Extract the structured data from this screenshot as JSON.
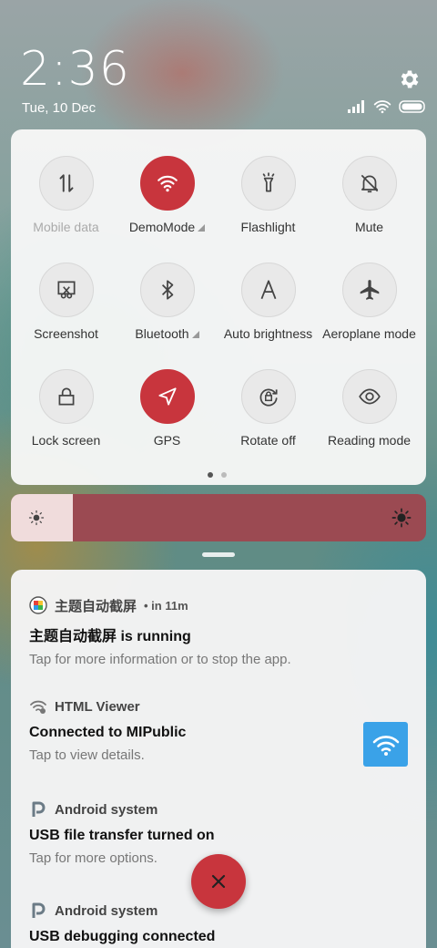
{
  "status": {
    "time": "2:36",
    "date": "Tue, 10 Dec"
  },
  "quick_settings": {
    "tiles": [
      {
        "label": "Mobile data",
        "icon": "mobile-data-icon",
        "active": false,
        "disabled": true
      },
      {
        "label": "DemoMode",
        "icon": "wifi-icon",
        "active": true,
        "expand": true
      },
      {
        "label": "Flashlight",
        "icon": "flashlight-icon",
        "active": false
      },
      {
        "label": "Mute",
        "icon": "bell-off-icon",
        "active": false
      },
      {
        "label": "Screenshot",
        "icon": "screenshot-icon",
        "active": false
      },
      {
        "label": "Bluetooth",
        "icon": "bluetooth-icon",
        "active": false,
        "expand": true
      },
      {
        "label": "Auto brightness",
        "icon": "auto-brightness-icon",
        "active": false
      },
      {
        "label": "Aeroplane mode",
        "icon": "airplane-icon",
        "active": false
      },
      {
        "label": "Lock screen",
        "icon": "lock-icon",
        "active": false
      },
      {
        "label": "GPS",
        "icon": "location-icon",
        "active": true
      },
      {
        "label": "Rotate off",
        "icon": "rotate-lock-icon",
        "active": false
      },
      {
        "label": "Reading mode",
        "icon": "eye-icon",
        "active": false
      }
    ],
    "page": 1,
    "page_count": 2
  },
  "brightness": {
    "level": 0.15
  },
  "notifications": [
    {
      "app": "主题自动截屏",
      "time": "• in 11m",
      "title": "主题自动截屏 is running",
      "text": "Tap for more information or to stop the app.",
      "icon": "theme-app-icon"
    },
    {
      "app": "HTML Viewer",
      "time": "",
      "title": "Connected to MIPublic",
      "text": "Tap to view details.",
      "icon": "wifi-settings-icon"
    },
    {
      "app": "Android system",
      "time": "",
      "title": "USB file transfer turned on",
      "text": "Tap for more options.",
      "icon": "android-system-icon"
    },
    {
      "app": "Android system",
      "time": "",
      "title": "USB debugging connected",
      "text": "",
      "icon": "android-system-icon"
    }
  ],
  "colors": {
    "accent": "#c8353d",
    "brightness_track": "#9b4a52",
    "wifi_tile": "#3aa2e8"
  }
}
